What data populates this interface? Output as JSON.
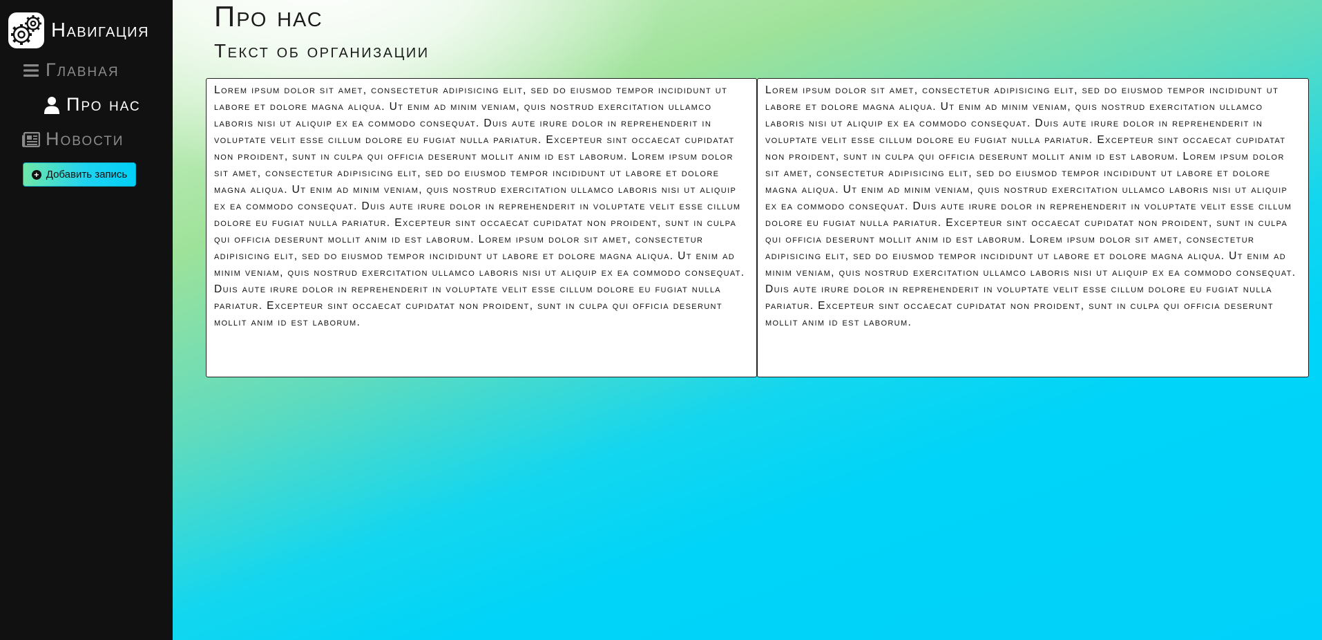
{
  "sidebar": {
    "brand": {
      "title": "Навигация",
      "logo_icon": "gears-icon"
    },
    "items": [
      {
        "label": "Главная",
        "icon": "bars-icon",
        "active": false
      },
      {
        "label": "Про нас",
        "icon": "user-icon",
        "active": true
      },
      {
        "label": "Новости",
        "icon": "newspaper-icon",
        "active": false
      }
    ],
    "add_button": {
      "label": "Добавить запись",
      "icon": "plus-circle-icon"
    }
  },
  "main": {
    "title": "Про нас",
    "subtitle": "Текст об организации",
    "columns": [
      "Lorem ipsum dolor sit amet, consectetur adipisicing elit, sed do eiusmod tempor incididunt ut labore et dolore magna aliqua. Ut enim ad minim veniam, quis nostrud exercitation ullamco laboris nisi ut aliquip ex ea commodo consequat. Duis aute irure dolor in reprehenderit in voluptate velit esse cillum dolore eu fugiat nulla pariatur. Excepteur sint occaecat cupidatat non proident, sunt in culpa qui officia deserunt mollit anim id est laborum. Lorem ipsum dolor sit amet, consectetur adipisicing elit, sed do eiusmod tempor incididunt ut labore et dolore magna aliqua. Ut enim ad minim veniam, quis nostrud exercitation ullamco laboris nisi ut aliquip ex ea commodo consequat. Duis aute irure dolor in reprehenderit in voluptate velit esse cillum dolore eu fugiat nulla pariatur. Excepteur sint occaecat cupidatat non proident, sunt in culpa qui officia deserunt mollit anim id est laborum. Lorem ipsum dolor sit amet, consectetur adipisicing elit, sed do eiusmod tempor incididunt ut labore et dolore magna aliqua. Ut enim ad minim veniam, quis nostrud exercitation ullamco laboris nisi ut aliquip ex ea commodo consequat. Duis aute irure dolor in reprehenderit in voluptate velit esse cillum dolore eu fugiat nulla pariatur. Excepteur sint occaecat cupidatat non proident, sunt in culpa qui officia deserunt mollit anim id est laborum.",
      "Lorem ipsum dolor sit amet, consectetur adipisicing elit, sed do eiusmod tempor incididunt ut labore et dolore magna aliqua. Ut enim ad minim veniam, quis nostrud exercitation ullamco laboris nisi ut aliquip ex ea commodo consequat. Duis aute irure dolor in reprehenderit in voluptate velit esse cillum dolore eu fugiat nulla pariatur. Excepteur sint occaecat cupidatat non proident, sunt in culpa qui officia deserunt mollit anim id est laborum. Lorem ipsum dolor sit amet, consectetur adipisicing elit, sed do eiusmod tempor incididunt ut labore et dolore magna aliqua. Ut enim ad minim veniam, quis nostrud exercitation ullamco laboris nisi ut aliquip ex ea commodo consequat. Duis aute irure dolor in reprehenderit in voluptate velit esse cillum dolore eu fugiat nulla pariatur. Excepteur sint occaecat cupidatat non proident, sunt in culpa qui officia deserunt mollit anim id est laborum. Lorem ipsum dolor sit amet, consectetur adipisicing elit, sed do eiusmod tempor incididunt ut labore et dolore magna aliqua. Ut enim ad minim veniam, quis nostrud exercitation ullamco laboris nisi ut aliquip ex ea commodo consequat. Duis aute irure dolor in reprehenderit in voluptate velit esse cillum dolore eu fugiat nulla pariatur. Excepteur sint occaecat cupidatat non proident, sunt in culpa qui officia deserunt mollit anim id est laborum."
    ]
  },
  "colors": {
    "sidebar_bg": "#111111",
    "accent": "#00d1fb",
    "active_text": "#ffffff",
    "inactive_text": "#8a8a8a"
  }
}
